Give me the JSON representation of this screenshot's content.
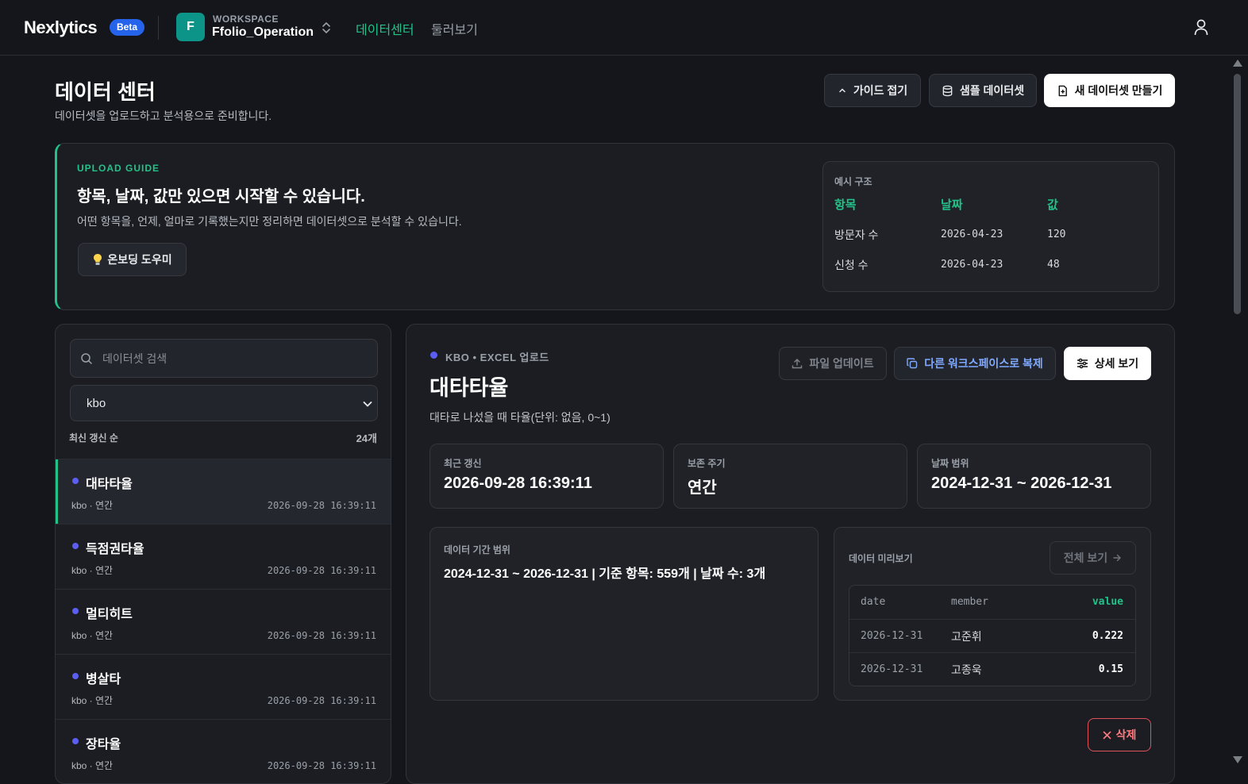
{
  "header": {
    "logo": "Nexlytics",
    "badge": "Beta",
    "workspace_initial": "F",
    "workspace_label": "WORKSPACE",
    "workspace_name": "Ffolio_Operation",
    "nav": [
      "데이터센터",
      "둘러보기"
    ],
    "active_color": "#22c389"
  },
  "page": {
    "title": "데이터 센터",
    "subtitle": "데이터셋을 업로드하고 분석용으로 준비합니다.",
    "buttons": {
      "guide": "가이드 접기",
      "sample": "샘플 데이터셋",
      "new": "새 데이터셋 만들기"
    }
  },
  "guide": {
    "tag": "UPLOAD GUIDE",
    "title": "항목, 날짜, 값만 있으면 시작할 수 있습니다.",
    "desc": "어떤 항목을, 언제, 얼마로 기록했는지만 정리하면 데이터셋으로 분석할 수 있습니다.",
    "onboarding": "온보딩 도우미",
    "example": {
      "title": "예시 구조",
      "headers": [
        "항목",
        "날짜",
        "값"
      ],
      "rows": [
        [
          "방문자 수",
          "2026-04-23",
          "120"
        ],
        [
          "신청 수",
          "2026-04-23",
          "48"
        ]
      ]
    }
  },
  "sidebar": {
    "search_placeholder": "데이터셋 검색",
    "filter_value": "kbo",
    "sort_label": "최신 갱신 순",
    "count": "24개",
    "items": [
      {
        "name": "대타타율",
        "meta": "kbo · 연간",
        "time": "2026-09-28 16:39:11"
      },
      {
        "name": "득점권타율",
        "meta": "kbo · 연간",
        "time": "2026-09-28 16:39:11"
      },
      {
        "name": "멀티히트",
        "meta": "kbo · 연간",
        "time": "2026-09-28 16:39:11"
      },
      {
        "name": "병살타",
        "meta": "kbo · 연간",
        "time": "2026-09-28 16:39:11"
      },
      {
        "name": "장타율",
        "meta": "kbo · 연간",
        "time": "2026-09-28 16:39:11"
      }
    ]
  },
  "detail": {
    "source": "KBO • EXCEL 업로드",
    "title": "대타타율",
    "desc": "대타로 나섰을 때 타율(단위: 없음, 0~1)",
    "buttons": {
      "file_update": "파일 업데이트",
      "duplicate": "다른 워크스페이스로 복제",
      "detail": "상세 보기",
      "view_all": "전체 보기",
      "delete": "삭제"
    },
    "stats": [
      {
        "label": "최근 갱신",
        "value": "2026-09-28 16:39:11"
      },
      {
        "label": "보존 주기",
        "value": "연간"
      },
      {
        "label": "날짜 범위",
        "value": "2024-12-31 ~ 2026-12-31"
      }
    ],
    "range": {
      "label": "데이터 기간 범위",
      "value": "2024-12-31 ~ 2026-12-31 | 기준 항목: 559개 | 날짜 수: 3개"
    },
    "preview": {
      "label": "데이터 미리보기",
      "columns": [
        "date",
        "member",
        "value"
      ],
      "rows": [
        [
          "2026-12-31",
          "고준휘",
          "0.222"
        ],
        [
          "2026-12-31",
          "고종욱",
          "0.15"
        ]
      ]
    }
  }
}
